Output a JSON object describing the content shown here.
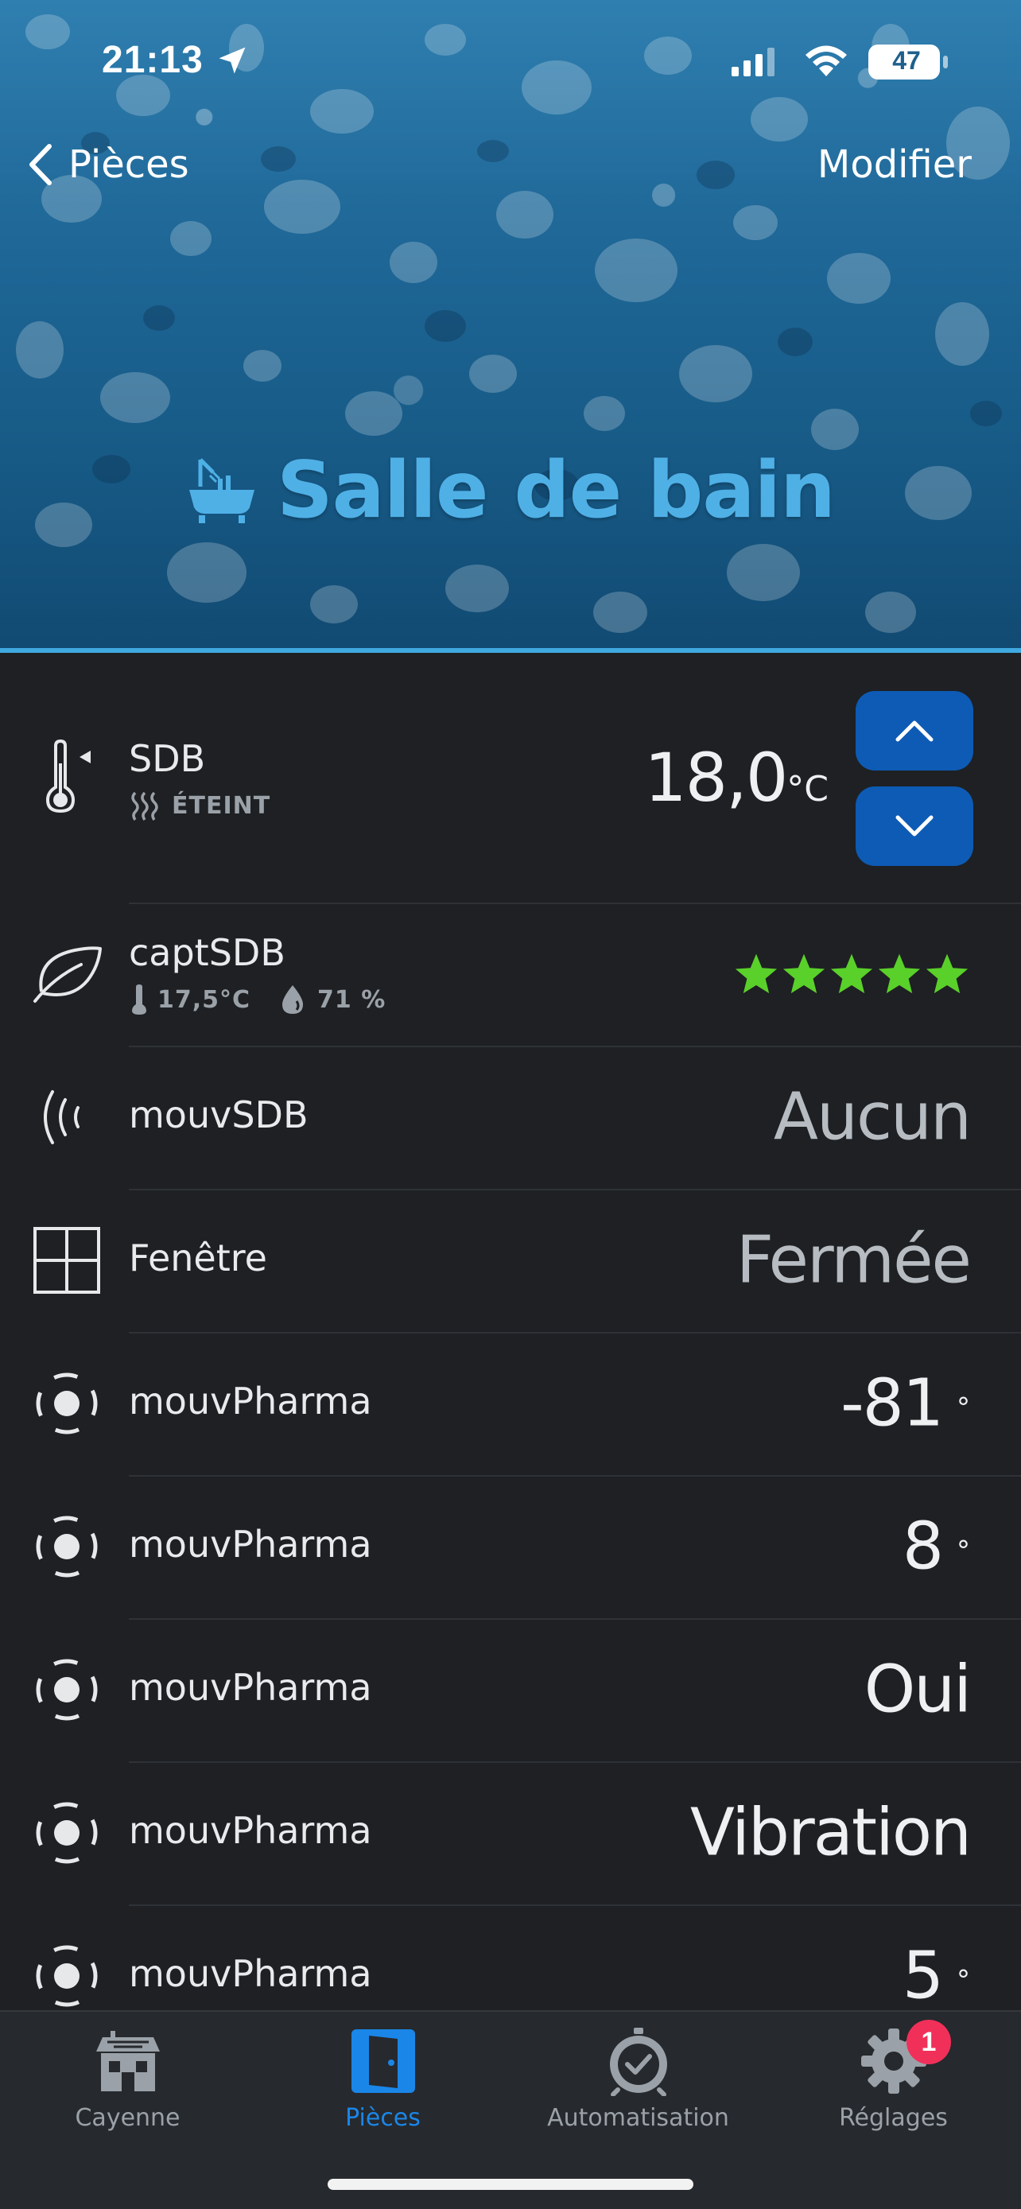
{
  "status_bar": {
    "time": "21:13",
    "battery": "47"
  },
  "nav": {
    "back_label": "Pièces",
    "edit_label": "Modifier"
  },
  "room": {
    "title": "Salle de bain"
  },
  "thermostat": {
    "name": "SDB",
    "status": "ÉTEINT",
    "temperature": "18,0",
    "unit": "°C"
  },
  "sensor": {
    "name": "captSDB",
    "temperature": "17,5°C",
    "humidity": "71 %",
    "rating": 5
  },
  "rows": [
    {
      "name": "mouvSDB",
      "value": "Aucun",
      "icon": "motion-icon"
    },
    {
      "name": "Fenêtre",
      "value": "Fermée",
      "icon": "window-icon"
    },
    {
      "name": "mouvPharma",
      "value": "-81",
      "unit": "°",
      "icon": "sensor-icon"
    },
    {
      "name": "mouvPharma",
      "value": "8",
      "unit": "°",
      "icon": "sensor-icon"
    },
    {
      "name": "mouvPharma",
      "value": "Oui",
      "icon": "sensor-icon"
    },
    {
      "name": "mouvPharma",
      "value": "Vibration",
      "icon": "sensor-icon"
    },
    {
      "name": "mouvPharma",
      "value": "5",
      "unit": "°",
      "icon": "sensor-icon"
    }
  ],
  "tabs": [
    {
      "label": "Cayenne",
      "icon": "house-icon"
    },
    {
      "label": "Pièces",
      "icon": "door-icon",
      "active": true
    },
    {
      "label": "Automatisation",
      "icon": "alarm-clock-icon"
    },
    {
      "label": "Réglages",
      "icon": "gear-icon",
      "badge": "1"
    }
  ],
  "colors": {
    "accent": "#1a86e8",
    "button": "#0d5bb5",
    "stars": "#5ad02a",
    "badge": "#f1305a",
    "title": "#4fb0e6"
  }
}
